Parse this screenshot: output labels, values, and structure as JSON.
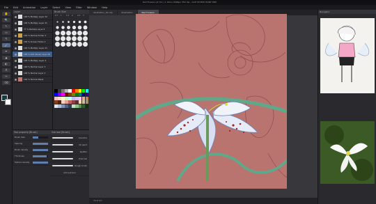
{
  "window": {
    "title": "Red Flowers (# 01) | 1 10ms 4096px 350 dpi - CLIP STUDIO PAINT PRO"
  },
  "menu": [
    "File",
    "Edit",
    "Animation",
    "Layer",
    "Select",
    "View",
    "Filter",
    "Window",
    "Help"
  ],
  "tools": [
    "✋",
    "🔍",
    "↖",
    "▭",
    "✎",
    "🖌",
    "✒",
    "▲",
    "◐",
    "A",
    "✂",
    "⌫"
  ],
  "layers": {
    "header": "Layer",
    "items": [
      {
        "name": "100 % Multiply Layer 32"
      },
      {
        "name": "100 % Multiply Layer 31"
      },
      {
        "name": "77 % Multiply Layer 8"
      },
      {
        "name": "100 % Normal Folder 2"
      },
      {
        "name": "100 % Screen Folder 1"
      },
      {
        "name": "100 % Multiply Layer 21"
      },
      {
        "name": "100 % Add (Glow) Layer 20"
      },
      {
        "name": "100 % Multiply Layer 4"
      },
      {
        "name": "100 % Normal Layer 3"
      },
      {
        "name": "100 % Normal Layer 2"
      },
      {
        "name": "100 % Normal Paper"
      }
    ]
  },
  "brush_size": {
    "header": "Brush Size",
    "labels": [
      "0.7",
      "1",
      "1.5",
      "2",
      "2.5",
      "3",
      "4",
      "5",
      "6",
      "7",
      "8",
      "10"
    ]
  },
  "palette": {
    "header": "Color Set",
    "colors": [
      "#000000",
      "#3b3b3b",
      "#777777",
      "#b3b3b3",
      "#ffffff",
      "#ff0000",
      "#ff7f00",
      "#ffff00",
      "#00ff00",
      "#00ffff",
      "#0000ff",
      "#7f00ff",
      "#ff00ff",
      "#7f0000",
      "#7f3f00",
      "#7f7f00",
      "#007f00",
      "#007f7f",
      "#00007f",
      "#3f007f",
      "#ffbfbf",
      "#ffdfbf",
      "#ffffbf",
      "#bfffbf",
      "#bfffff",
      "#bfbfff",
      "#dfbfff",
      "#ffbfff",
      "#e0b08a",
      "#c08050",
      "#804020",
      "#502010",
      "#f5d0c0",
      "#e6a090",
      "#c06060",
      "#904040",
      "#603030",
      "#f0e0c0",
      "#d0c0a0",
      "#a09070",
      "#e0e8f0",
      "#b0c0d8",
      "#8090b0",
      "#506080",
      "#304050",
      "#c0e0c0",
      "#90c090",
      "#609060",
      "#306030",
      "#103010"
    ]
  },
  "tool_property": {
    "header": "Tool property [Brush]",
    "rows": [
      {
        "label": "Brush Size",
        "value": "6.5",
        "fill": 0.35
      },
      {
        "label": "Spacing",
        "value": "100",
        "fill": 1.0
      },
      {
        "label": "Brush density",
        "value": "100",
        "fill": 1.0
      },
      {
        "label": "Thickness",
        "value": "100.0",
        "fill": 0.9
      },
      {
        "label": "Texture density",
        "value": "100",
        "fill": 1.0
      }
    ]
  },
  "sub_tool": {
    "header": "Sub tool [Brush]",
    "rows": [
      {
        "label": "Gouache"
      },
      {
        "label": "Oil paint"
      },
      {
        "label": "Spatter"
      },
      {
        "label": "Charcoal"
      },
      {
        "label": "Rough brush"
      }
    ],
    "add_label": "Add sub tool"
  },
  "canvas": {
    "tabs": [
      "Illustration_10.clip",
      "Illustration",
      "Red Flowers"
    ],
    "active_tab": 2,
    "status": "15.6   0.0"
  },
  "navigator": {
    "header": "Navigator"
  },
  "colors": {
    "fg": "#0e3f44",
    "bg": "#ffffff",
    "canvas": "#b97470",
    "lily": "#ffffff"
  }
}
